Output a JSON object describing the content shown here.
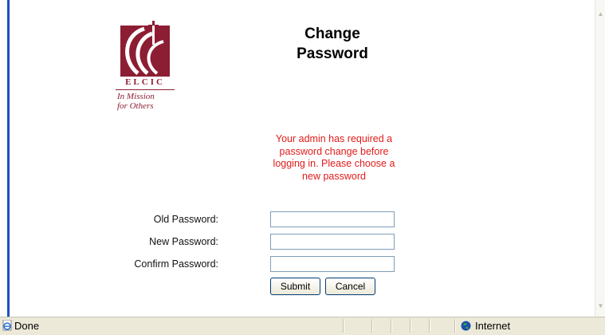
{
  "page": {
    "title_line1": "Change",
    "title_line2": "Password",
    "logo": {
      "acronym": "ELCIC",
      "tagline_line1": "In Mission",
      "tagline_line2": "for Others",
      "brand_color": "#8c1d32"
    },
    "notice": "Your admin has required a password change before logging in. Please choose a new password",
    "notice_color": "#e21b1b"
  },
  "form": {
    "old_password_label": "Old Password:",
    "new_password_label": "New Password:",
    "confirm_password_label": "Confirm Password:",
    "old_password_value": "",
    "new_password_value": "",
    "confirm_password_value": "",
    "submit_label": "Submit",
    "cancel_label": "Cancel"
  },
  "statusbar": {
    "status": "Done",
    "zone": "Internet",
    "icons": [
      "ie-page-icon",
      "globe-icon"
    ]
  }
}
